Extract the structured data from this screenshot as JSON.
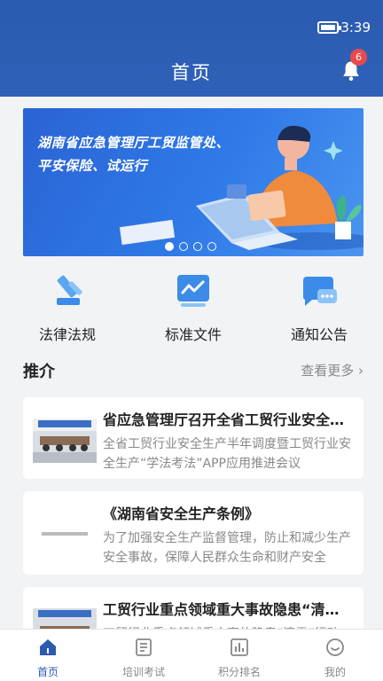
{
  "status_bar": {
    "time": "3:39"
  },
  "header": {
    "title": "首页",
    "notification_count": "6"
  },
  "banner": {
    "line1": "湖南省应急管理厅工贸监管处、",
    "line2": "平安保险、试运行",
    "page_count": 4,
    "active_index": 0
  },
  "quick_links": [
    {
      "label": "法律法规",
      "icon": "gavel-icon"
    },
    {
      "label": "标准文件",
      "icon": "chart-icon"
    },
    {
      "label": "通知公告",
      "icon": "message-icon"
    }
  ],
  "recommend": {
    "title": "推介",
    "more": "查看更多"
  },
  "articles": [
    {
      "title": "省应急管理厅召开全省工贸行业安全生产半年调度暨工贸行业安全生产“学法考法”APP应用推进会议",
      "desc": "全省工贸行业安全生产半年调度暨工贸行业安全生产“学法考法”APP应用推进会议"
    },
    {
      "title": "《湖南省安全生产条例》",
      "desc": "为了加强安全生产监督管理，防止和减少生产安全事故，保障人民群众生命和财产安全"
    },
    {
      "title": "工贸行业重点领域重大事故隐患“清零”行动",
      "desc": "工贸行业重点领域重大事故隐患“清零”行动"
    }
  ],
  "tabs": [
    {
      "label": "首页",
      "icon": "home-icon",
      "active": true
    },
    {
      "label": "培训考试",
      "icon": "training-icon",
      "active": false
    },
    {
      "label": "积分排名",
      "icon": "ranking-icon",
      "active": false
    },
    {
      "label": "我的",
      "icon": "profile-icon",
      "active": false
    }
  ],
  "colors": {
    "primary": "#2b5bb0",
    "badge": "#e94b4b",
    "banner": "#2f7ae8"
  }
}
